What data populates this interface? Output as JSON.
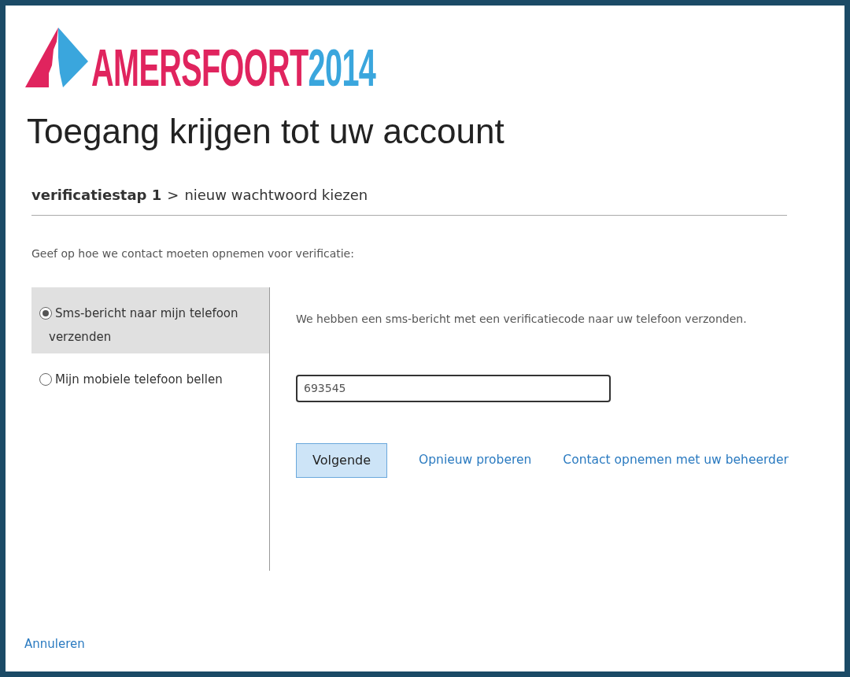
{
  "logo": {
    "name": "AMERSFOORT",
    "year": "2014"
  },
  "title": "Toegang krijgen tot uw account",
  "breadcrumb": [
    {
      "label": "verificatiestap 1",
      "current": true
    },
    {
      "label": "nieuw wachtwoord kiezen",
      "current": false
    }
  ],
  "breadcrumb_separator": ">",
  "instruction": "Geef op hoe we contact moeten opnemen voor verificatie:",
  "options": [
    {
      "label": "Sms-bericht naar mijn telefoon verzenden",
      "selected": true
    },
    {
      "label": "Mijn mobiele telefoon bellen",
      "selected": false
    }
  ],
  "message": "We hebben een sms-bericht met een verificatiecode naar uw telefoon verzonden.",
  "code_field": {
    "value": "693545"
  },
  "next_button": "Volgende",
  "links": [
    "Opnieuw proberen",
    "Contact opnemen met uw beheerder"
  ],
  "cancel_link": "Annuleren"
}
